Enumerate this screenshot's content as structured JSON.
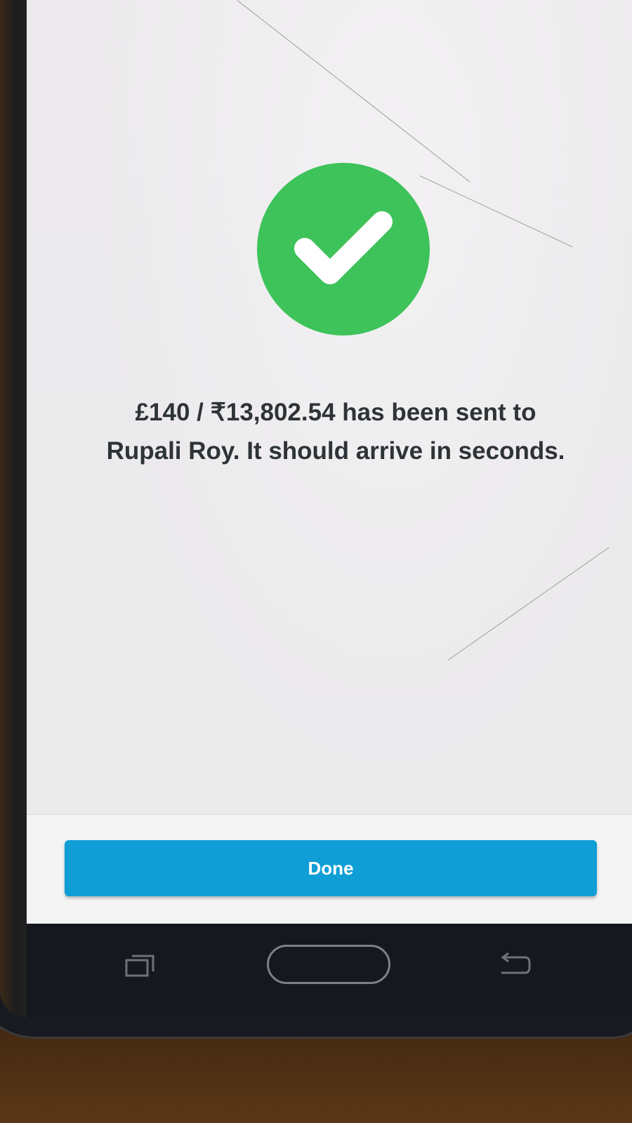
{
  "confirmation": {
    "line1": "£140 / ₹13,802.54 has been sent to",
    "line2": "Rupali Roy. It should arrive in seconds."
  },
  "footer": {
    "done_label": "Done"
  },
  "colors": {
    "success": "#3ec35a",
    "accent": "#0f9fd6",
    "text": "#2e3338",
    "background": "#ecebec"
  },
  "icons": {
    "status": "checkmark-circle-icon",
    "nav_recent": "recent-apps-icon",
    "nav_home": "home-button",
    "nav_back": "back-icon"
  }
}
